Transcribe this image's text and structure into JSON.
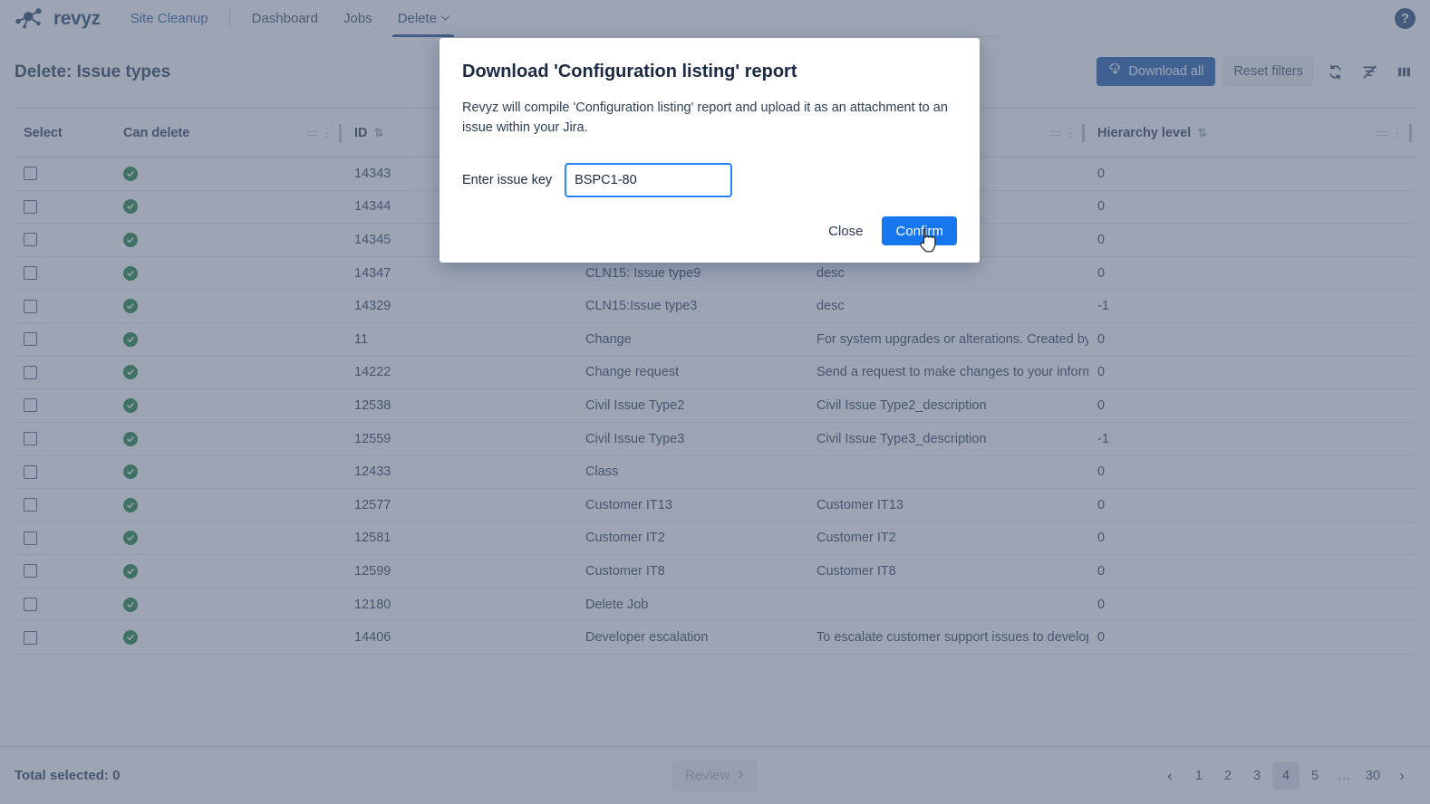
{
  "nav": {
    "brand": "revyz",
    "brand_icon": "revyz-molecule-logo",
    "site_cleanup": "Site Cleanup",
    "items": [
      {
        "label": "Dashboard",
        "active": false
      },
      {
        "label": "Jobs",
        "active": false
      },
      {
        "label": "Delete",
        "active": true,
        "has_caret": true
      }
    ],
    "help_label": "?"
  },
  "page": {
    "title": "Delete: Issue types",
    "actions": {
      "download_all": "Download all",
      "download_icon": "cloud-download-icon",
      "reset_filters": "Reset filters",
      "refresh_icon": "refresh-icon",
      "filter_off_icon": "filter-off-icon",
      "columns_icon": "columns-icon"
    }
  },
  "table": {
    "columns": [
      {
        "key": "select",
        "label": "Select",
        "sortable": false,
        "tools": false
      },
      {
        "key": "can_delete",
        "label": "Can delete",
        "sortable": false,
        "tools": true
      },
      {
        "key": "id",
        "label": "ID",
        "sortable": true,
        "tools": true
      },
      {
        "key": "name",
        "label": "",
        "sortable": false,
        "tools": false
      },
      {
        "key": "description",
        "label": "",
        "sortable": false,
        "tools": true
      },
      {
        "key": "hierarchy_level",
        "label": "Hierarchy level",
        "sortable": true,
        "tools": true
      }
    ],
    "sort_icon": "sort-updown-icon",
    "rows": [
      {
        "can_delete": true,
        "id": "14343",
        "name": "",
        "description": "",
        "hierarchy_level": "0"
      },
      {
        "can_delete": true,
        "id": "14344",
        "name": "",
        "description": "",
        "hierarchy_level": "0"
      },
      {
        "can_delete": true,
        "id": "14345",
        "name": "",
        "description": "",
        "hierarchy_level": "0"
      },
      {
        "can_delete": true,
        "id": "14347",
        "name": "CLN15: Issue type9",
        "description": "desc",
        "hierarchy_level": "0"
      },
      {
        "can_delete": true,
        "id": "14329",
        "name": "CLN15:Issue type3",
        "description": "desc",
        "hierarchy_level": "-1"
      },
      {
        "can_delete": true,
        "id": "11",
        "name": "Change",
        "description": "For system upgrades or alterations. Created by",
        "hierarchy_level": "0"
      },
      {
        "can_delete": true,
        "id": "14222",
        "name": "Change request",
        "description": "Send a request to make changes to your inform",
        "hierarchy_level": "0"
      },
      {
        "can_delete": true,
        "id": "12538",
        "name": "Civil Issue Type2",
        "description": "Civil Issue Type2_description",
        "hierarchy_level": "0"
      },
      {
        "can_delete": true,
        "id": "12559",
        "name": "Civil Issue Type3",
        "description": "Civil Issue Type3_description",
        "hierarchy_level": "-1"
      },
      {
        "can_delete": true,
        "id": "12433",
        "name": "Class",
        "description": "",
        "hierarchy_level": "0"
      },
      {
        "can_delete": true,
        "id": "12577",
        "name": "Customer IT13",
        "description": "Customer IT13",
        "hierarchy_level": "0"
      },
      {
        "can_delete": true,
        "id": "12581",
        "name": "Customer IT2",
        "description": "Customer IT2",
        "hierarchy_level": "0"
      },
      {
        "can_delete": true,
        "id": "12599",
        "name": "Customer IT8",
        "description": "Customer IT8",
        "hierarchy_level": "0"
      },
      {
        "can_delete": true,
        "id": "12180",
        "name": "Delete Job",
        "description": "",
        "hierarchy_level": "0"
      },
      {
        "can_delete": true,
        "id": "14406",
        "name": "Developer escalation",
        "description": "To escalate customer support issues to develop",
        "hierarchy_level": "0"
      }
    ]
  },
  "footer": {
    "total_selected": "Total selected: 0",
    "review_label": "Review",
    "review_icon": "chevron-right-icon",
    "pagination": {
      "prev_icon": "chevron-left-icon",
      "next_icon": "chevron-right-icon",
      "pages": [
        "1",
        "2",
        "3",
        "4",
        "5",
        "…",
        "30"
      ],
      "current": "4"
    }
  },
  "modal": {
    "title": "Download 'Configuration listing' report",
    "body": "Revyz will compile 'Configuration listing' report and upload it as an attachment to an issue within your Jira.",
    "field_label": "Enter issue key",
    "field_value": "BSPC1-80",
    "field_placeholder": "",
    "close_label": "Close",
    "confirm_label": "Confirm"
  },
  "colors": {
    "brand_navy": "#17375e",
    "primary_blue": "#0b4ea2",
    "confirm_blue": "#1677ee",
    "link_blue": "#1f5fbf",
    "success_green": "#0a7a2e",
    "scrim": "#616e88"
  }
}
